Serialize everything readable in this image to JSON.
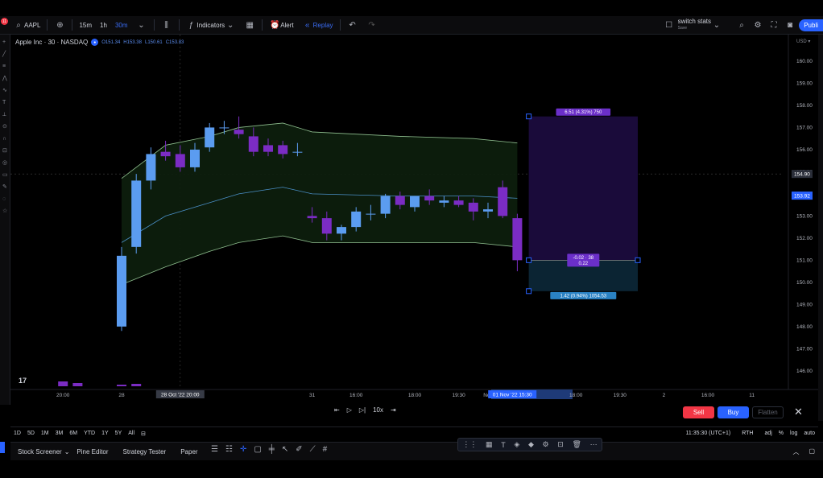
{
  "header": {
    "badge": "11",
    "symbol": "AAPL",
    "intervals": [
      "15m",
      "1h",
      "30m"
    ],
    "indicators_label": "Indicators",
    "alert_label": "Alert",
    "replay_label": "Replay",
    "layout_name": "switch stats",
    "layout_sub": "Save",
    "publish_label": "Publi"
  },
  "legend": {
    "title": "Apple Inc · 30 · NASDAQ",
    "ohlc": [
      "O151.34",
      "H153.38",
      "L150.61",
      "C153.83"
    ]
  },
  "chart_data": {
    "type": "candlestick",
    "currency": "USD",
    "ylim": [
      145.3,
      161.2
    ],
    "y_ticks": [
      146,
      147,
      148,
      149,
      150,
      151,
      152,
      153,
      154,
      155,
      156,
      157,
      158,
      159,
      160
    ],
    "x_ticks": [
      {
        "label": "20:00",
        "bar": 1
      },
      {
        "label": "28",
        "bar": 5
      },
      {
        "label": "18:00",
        "bar": 10
      },
      {
        "label": "31",
        "bar": 18
      },
      {
        "label": "16:00",
        "bar": 21
      },
      {
        "label": "18:00",
        "bar": 25
      },
      {
        "label": "19:30",
        "bar": 28
      },
      {
        "label": "Nov",
        "bar": 30
      },
      {
        "label": "18:00",
        "bar": 36
      },
      {
        "label": "19:30",
        "bar": 39
      },
      {
        "label": "2",
        "bar": 42
      },
      {
        "label": "16:00",
        "bar": 45
      },
      {
        "label": "11",
        "bar": 48
      }
    ],
    "crosshair_time": "28 Oct '22  20:00",
    "replay_time": "01 Nov '22  15:30",
    "price_labels": {
      "last": "154.90",
      "current": "153.92"
    },
    "candles": [
      {
        "bar": 5,
        "o": 148.0,
        "h": 151.6,
        "l": 147.8,
        "c": 151.2
      },
      {
        "bar": 6,
        "o": 151.6,
        "h": 154.9,
        "l": 151.3,
        "c": 154.6
      },
      {
        "bar": 7,
        "o": 154.6,
        "h": 156.1,
        "l": 154.2,
        "c": 155.8
      },
      {
        "bar": 8,
        "o": 155.9,
        "h": 156.4,
        "l": 155.5,
        "c": 155.7
      },
      {
        "bar": 9,
        "o": 155.8,
        "h": 156.2,
        "l": 155.0,
        "c": 155.2
      },
      {
        "bar": 10,
        "o": 155.2,
        "h": 156.3,
        "l": 155.0,
        "c": 156.0
      },
      {
        "bar": 11,
        "o": 156.1,
        "h": 157.2,
        "l": 155.9,
        "c": 157.0
      },
      {
        "bar": 12,
        "o": 157.0,
        "h": 157.3,
        "l": 156.7,
        "c": 157.0
      },
      {
        "bar": 13,
        "o": 156.9,
        "h": 157.5,
        "l": 156.5,
        "c": 156.7
      },
      {
        "bar": 14,
        "o": 156.6,
        "h": 157.0,
        "l": 155.7,
        "c": 155.9
      },
      {
        "bar": 15,
        "o": 156.2,
        "h": 156.5,
        "l": 155.7,
        "c": 155.9
      },
      {
        "bar": 16,
        "o": 156.2,
        "h": 156.4,
        "l": 155.6,
        "c": 155.8
      },
      {
        "bar": 17,
        "o": 155.9,
        "h": 156.3,
        "l": 155.7,
        "c": 155.9
      },
      {
        "bar": 18,
        "o": 153.0,
        "h": 153.4,
        "l": 152.7,
        "c": 152.9
      },
      {
        "bar": 19,
        "o": 152.9,
        "h": 153.2,
        "l": 151.9,
        "c": 152.2
      },
      {
        "bar": 20,
        "o": 152.2,
        "h": 152.6,
        "l": 151.9,
        "c": 152.5
      },
      {
        "bar": 21,
        "o": 152.5,
        "h": 153.4,
        "l": 152.3,
        "c": 153.2
      },
      {
        "bar": 22,
        "o": 153.1,
        "h": 153.5,
        "l": 152.8,
        "c": 153.1
      },
      {
        "bar": 23,
        "o": 153.1,
        "h": 154.0,
        "l": 152.9,
        "c": 153.9
      },
      {
        "bar": 24,
        "o": 153.9,
        "h": 154.1,
        "l": 153.3,
        "c": 153.5
      },
      {
        "bar": 25,
        "o": 153.4,
        "h": 153.9,
        "l": 153.2,
        "c": 153.9
      },
      {
        "bar": 26,
        "o": 153.9,
        "h": 154.2,
        "l": 153.5,
        "c": 153.7
      },
      {
        "bar": 27,
        "o": 153.6,
        "h": 153.9,
        "l": 153.4,
        "c": 153.7
      },
      {
        "bar": 28,
        "o": 153.7,
        "h": 153.9,
        "l": 153.4,
        "c": 153.5
      },
      {
        "bar": 29,
        "o": 153.6,
        "h": 153.8,
        "l": 152.8,
        "c": 153.2
      },
      {
        "bar": 30,
        "o": 153.2,
        "h": 153.6,
        "l": 152.9,
        "c": 153.3
      },
      {
        "bar": 31,
        "o": 154.3,
        "h": 154.6,
        "l": 152.9,
        "c": 153.0
      },
      {
        "bar": 32,
        "o": 152.9,
        "h": 153.1,
        "l": 150.5,
        "c": 151.0
      }
    ],
    "bands": {
      "upper": [
        [
          5,
          154.7
        ],
        [
          8,
          156.2
        ],
        [
          11,
          156.6
        ],
        [
          13,
          157.0
        ],
        [
          16,
          157.2
        ],
        [
          18,
          156.8
        ],
        [
          24,
          156.6
        ],
        [
          29,
          156.5
        ],
        [
          32,
          156.3
        ]
      ],
      "middle": [
        [
          5,
          151.8
        ],
        [
          8,
          153.0
        ],
        [
          11,
          153.6
        ],
        [
          13,
          154.0
        ],
        [
          16,
          154.3
        ],
        [
          18,
          154.0
        ],
        [
          24,
          153.9
        ],
        [
          29,
          153.9
        ],
        [
          32,
          153.8
        ]
      ],
      "lower": [
        [
          5,
          149.9
        ],
        [
          8,
          150.7
        ],
        [
          11,
          151.4
        ],
        [
          13,
          151.8
        ],
        [
          16,
          152.1
        ],
        [
          18,
          151.8
        ],
        [
          24,
          151.8
        ],
        [
          29,
          151.8
        ],
        [
          32,
          151.6
        ]
      ]
    },
    "position_tool": {
      "entry": 151.0,
      "target": 157.5,
      "stop": 149.6,
      "start_bar": 33,
      "end_bar": 40,
      "target_label": "6.51 (4.31%) 750",
      "mid_label_1": "-0.02 · 38",
      "mid_label_2": "0.22",
      "stop_label": "1.42 (0.94%) 1054.53"
    }
  },
  "replay": {
    "speed": "10x"
  },
  "trade": {
    "sell_label": "Sell",
    "buy_label": "Buy",
    "flatten_label": "Flatten"
  },
  "range": {
    "items": [
      "1D",
      "5D",
      "1M",
      "3M",
      "6M",
      "YTD",
      "1Y",
      "5Y",
      "All"
    ],
    "clock": "11:35:30 (UTC+1)",
    "session": "RTH",
    "adj": "adj",
    "pct": "%",
    "log": "log",
    "auto": "auto"
  },
  "bottom": {
    "tabs": [
      "Stock Screener",
      "Pine Editor",
      "Strategy Tester",
      "Paper"
    ]
  },
  "colors": {
    "bull": "#5b9cf0",
    "bear": "#7b2cc4",
    "band_upper": "#8fbf8f",
    "band_middle": "#4a8fc7",
    "band_lower": "#8fbf8f",
    "target_zone": "#1a0b3a",
    "stop_zone": "#0b2433"
  }
}
